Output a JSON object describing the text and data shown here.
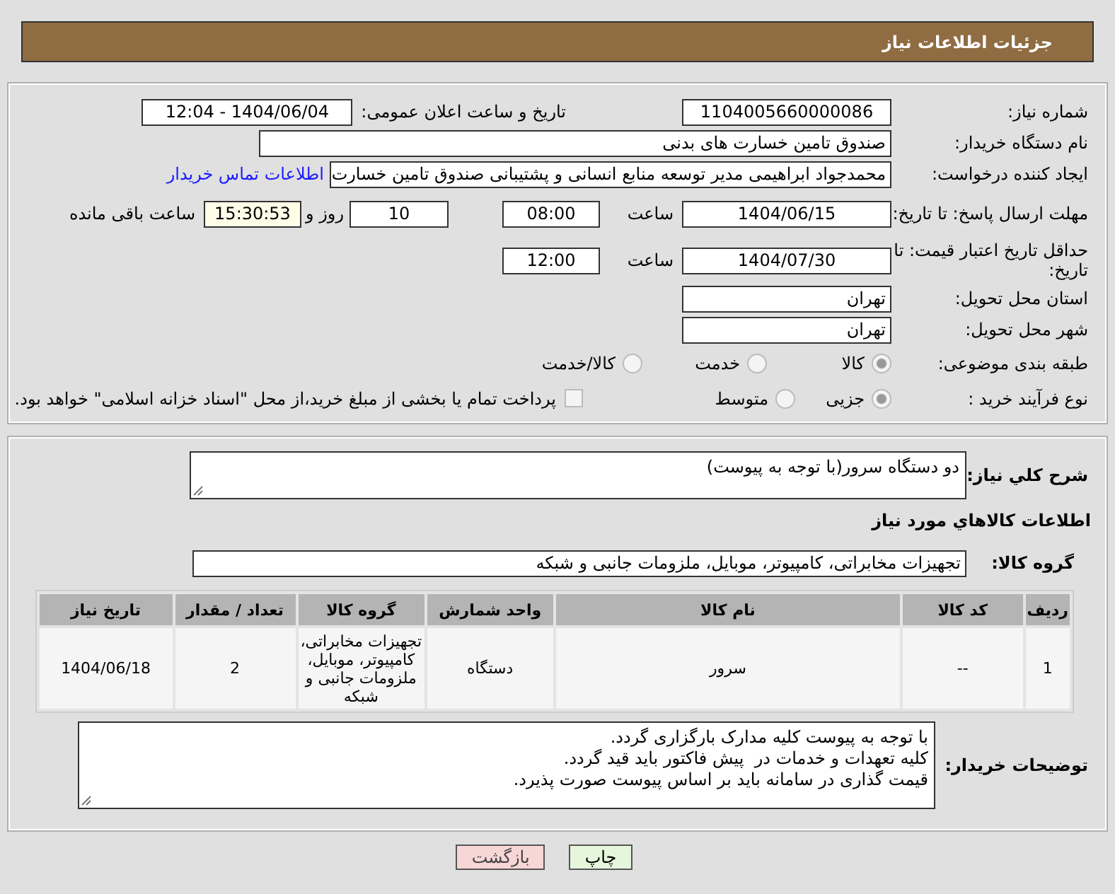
{
  "header": {
    "title": "جزئیات اطلاعات نیاز"
  },
  "need_number": {
    "label": "شماره نیاز:",
    "value": "1104005660000086"
  },
  "announce": {
    "label": "تاریخ و ساعت اعلان عمومی:",
    "value": "1404/06/04 - 12:04"
  },
  "buyer_org": {
    "label": "نام دستگاه خریدار:",
    "value": "صندوق تامین خسارت های بدنی"
  },
  "requester": {
    "label": "ایجاد کننده درخواست:",
    "value": "محمدجواد ابراهیمی مدیر توسعه منابع انسانی و پشتیبانی صندوق تامین خسارت",
    "link": "اطلاعات تماس خریدار"
  },
  "reply_deadline": {
    "label": "مهلت ارسال پاسخ: تا تاریخ:",
    "date": "1404/06/15",
    "time_label": "ساعت",
    "time": "08:00",
    "days": "10",
    "days_label": "روز و",
    "remaining": "15:30:53",
    "remaining_label": "ساعت باقی مانده"
  },
  "price_validity": {
    "label": "حداقل تاریخ اعتبار قیمت: تا تاریخ:",
    "date": "1404/07/30",
    "time_label": "ساعت",
    "time": "12:00"
  },
  "province": {
    "label": "استان محل تحویل:",
    "value": "تهران"
  },
  "city": {
    "label": "شهر محل تحویل:",
    "value": "تهران"
  },
  "category": {
    "label": "طبقه بندی موضوعی:",
    "options": [
      {
        "label": "کالا",
        "selected": true
      },
      {
        "label": "خدمت",
        "selected": false
      },
      {
        "label": "کالا/خدمت",
        "selected": false
      }
    ]
  },
  "purchase_type": {
    "label": "نوع فرآیند خرید :",
    "options": [
      {
        "label": "جزیی",
        "selected": true
      },
      {
        "label": "متوسط",
        "selected": false
      }
    ],
    "payment_note": {
      "label": "پرداخت تمام یا بخشی از مبلغ خرید،از محل \"اسناد خزانه اسلامی\" خواهد بود.",
      "checked": false
    }
  },
  "description": {
    "label": "شرح کلي نياز:",
    "value": "دو دستگاه سرور(با توجه به پیوست)"
  },
  "goods_heading": "اطلاعات کالاهاي مورد نياز",
  "goods_group": {
    "label": "گروه کالا:",
    "value": "تجهیزات مخابراتی، کامپیوتر، موبایل، ملزومات جانبی و شبکه"
  },
  "table": {
    "columns": [
      "ردیف",
      "کد کالا",
      "نام کالا",
      "واحد شمارش",
      "گروه کالا",
      "تعداد / مقدار",
      "تاریخ نیاز"
    ],
    "rows": [
      [
        "1",
        "--",
        "سرور",
        "دستگاه",
        "تجهیزات مخابراتی، کامپیوتر، موبایل، ملزومات جانبی و شبکه",
        "2",
        "1404/06/18"
      ]
    ]
  },
  "buyer_notes": {
    "label": "توضیحات خریدار:",
    "lines": [
      "با توجه به پیوست کلیه مدارک بارگزاری گردد.",
      "کلیه تعهدات و خدمات در  پیش فاکتور باید قید گردد.",
      "قیمت گذاری در سامانه باید بر اساس پیوست صورت پذیرد."
    ]
  },
  "buttons": [
    {
      "label": "چاپ",
      "kind": "print"
    },
    {
      "label": "بازگشت",
      "kind": "back"
    }
  ]
}
